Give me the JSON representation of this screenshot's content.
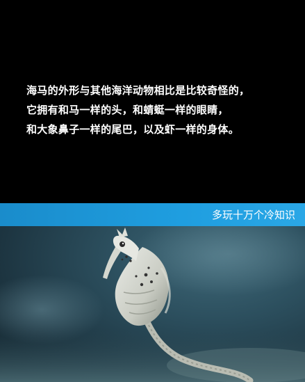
{
  "caption": {
    "lines": [
      "海马的外形与其他海洋动物相比是比较奇怪的，",
      "它拥有和马一样的头，和蜻蜓一样的眼睛，",
      "和大象鼻子一样的尾巴，以及虾一样的身体。"
    ]
  },
  "banner": {
    "label": "多玩十万个冷知识",
    "color": "#1f9ee0"
  },
  "photo": {
    "subject": "seahorse-illustration"
  }
}
